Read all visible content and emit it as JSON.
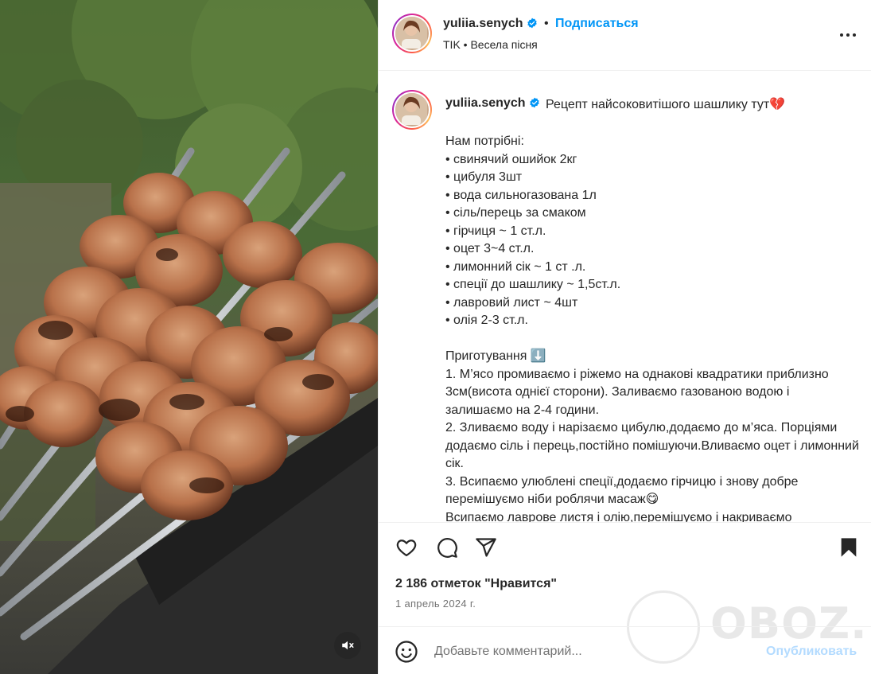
{
  "post": {
    "username": "yuliia.senych",
    "follow_label": "Подписаться",
    "separator": "•",
    "audio": "TIK • Весела пісня",
    "caption_title": "Рецепт найсоковитішого шашлику тут💔",
    "caption_lines": {
      "needed": "Нам потрібні:",
      "i1": "• свинячий ошийок 2кг",
      "i2": "• цибуля 3шт",
      "i3": "• вода сильногазована 1л",
      "i4": "• сіль/перець за смаком",
      "i5": "• гірчиця ~ 1 ст.л.",
      "i6": "• оцет 3~4 ст.л.",
      "i7": "• лимонний сік ~ 1 ст .л.",
      "i8": "• спеції до шашлику ~ 1,5ст.л.",
      "i9": "• лавровий лист ~ 4шт",
      "i10": "• олія 2-3 ст.л.",
      "prep": "Приготування ⬇️",
      "s1": "1. М’ясо промиваємо і ріжемо на однакові квадратики приблизно 3см(висота однієї сторони). Заливаємо газованою водою і залишаємо на 2-4 години.",
      "s2": "2. Зливаємо воду і нарізаємо цибулю,додаємо до м’яса. Порціями додаємо сіль і перець,постійно помішуючи.Вливаємо оцет і лимонний сік.",
      "s3": "3. Всипаємо улюблені спеції,додаємо гірчицю і знову добре перемішуємо ніби роблячи масаж😋",
      "s4": "Всипаємо лаврове листя і олію,перемішуємо і накриваємо"
    },
    "likes": "2 186 отметок \"Нравится\"",
    "date": "1 апрель 2024 г."
  },
  "comment": {
    "placeholder": "Добавьте комментарий...",
    "publish_label": "Опубликовать"
  },
  "watermark": "OBOZ.UA",
  "icons": {
    "like": "heart-icon",
    "comment": "comment-icon",
    "share": "share-icon",
    "save": "bookmark-icon",
    "more": "more-icon",
    "emoji": "emoji-icon",
    "mute": "volume-muted-icon",
    "verified": "verified-badge-icon"
  },
  "colors": {
    "link": "#0095f6",
    "publish_disabled": "#b3dbff",
    "text": "#262626",
    "secondary": "#737373"
  }
}
